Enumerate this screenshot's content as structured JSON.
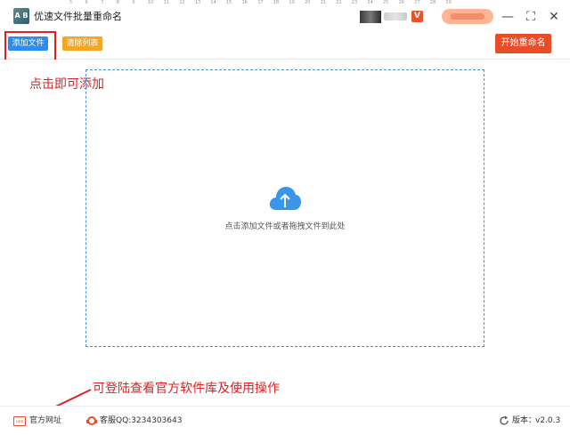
{
  "ruler": {
    "ticks": [
      "5",
      "6",
      "7",
      "8",
      "9",
      "10",
      "11",
      "12",
      "13",
      "14",
      "15",
      "16",
      "17",
      "18",
      "19",
      "20",
      "21",
      "22",
      "23",
      "24",
      "25",
      "26",
      "27",
      "28",
      "29"
    ]
  },
  "window": {
    "logo_text": "A B",
    "title": "优速文件批量重命名",
    "vip_badge": "V",
    "minimize_glyph": "—",
    "maximize_glyph": "⛶",
    "close_glyph": "✕"
  },
  "toolbar": {
    "add_files_label": "添加文件",
    "clear_list_label": "清除列表",
    "start_rename_label": "开始重命名"
  },
  "annotations": {
    "click_to_add": "点击即可添加",
    "visit_site_hint": "可登陆查看官方软件库及使用操作"
  },
  "drop_zone": {
    "icon": "cloud-upload-icon",
    "hint": "点击添加文件或者拖拽文件到此处"
  },
  "status": {
    "site_icon_text": "com",
    "site_link_label": "官方网址",
    "support_label": "客服QQ:3234303643",
    "version_label": "版本：",
    "version_value": "v2.0.3"
  },
  "colors": {
    "add_button": "#2d8cf0",
    "clear_button": "#f5a623",
    "start_button": "#e84d2a",
    "annotation_red": "#e02020",
    "drop_border": "#4a90d9"
  }
}
